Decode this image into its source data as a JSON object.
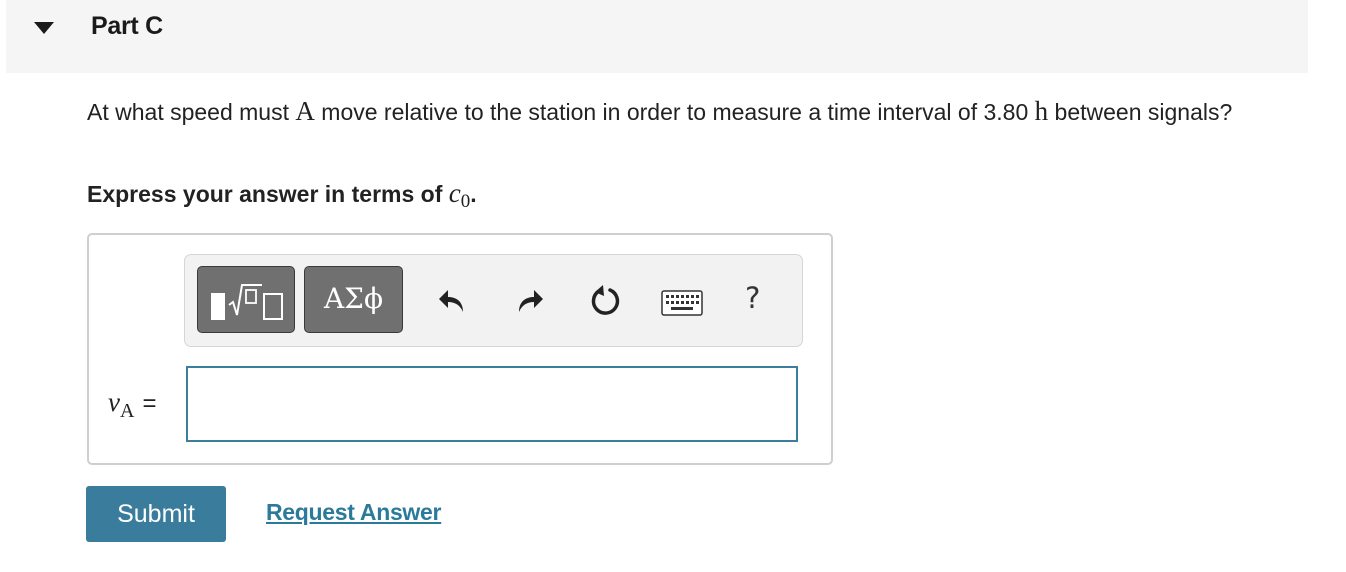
{
  "part": {
    "title": "Part C"
  },
  "question": {
    "text_before": "At what speed must ",
    "symbol_a": "A",
    "text_middle": " move relative to the station in order to measure a time interval of 3.80 ",
    "unit": "h",
    "text_after": " between signals?"
  },
  "instruction": {
    "text": "Express your answer in terms of ",
    "variable": "c",
    "subscript": "0",
    "period": "."
  },
  "toolbar": {
    "greek_label": "ΑΣϕ",
    "help_label": "?",
    "icons": [
      "template-icon",
      "greek-symbols",
      "undo-icon",
      "redo-icon",
      "reset-icon",
      "keyboard-icon",
      "help-icon"
    ]
  },
  "answer": {
    "variable": "v",
    "subscript": "A",
    "equals": "=",
    "value": "",
    "placeholder": ""
  },
  "actions": {
    "submit_label": "Submit",
    "request_label": "Request Answer"
  },
  "colors": {
    "accent": "#3a7c9c",
    "link": "#2b7a9b",
    "toolbar_button": "#707070",
    "header_bg": "#f5f5f5"
  }
}
